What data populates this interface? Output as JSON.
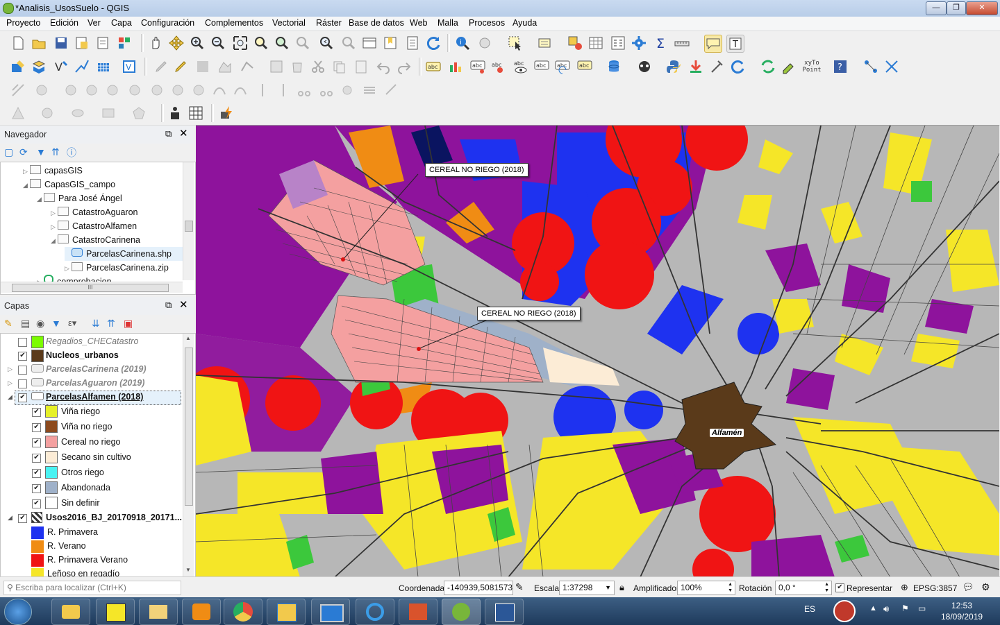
{
  "window": {
    "title": "*Analisis_UsosSuelo - QGIS",
    "minimize": "—",
    "maximize": "❐",
    "close": "✕"
  },
  "menu": [
    "Proyecto",
    "Edición",
    "Ver",
    "Capa",
    "Configuración",
    "Complementos",
    "Vectorial",
    "Ráster",
    "Base de datos",
    "Web",
    "Malla",
    "Procesos",
    "Ayuda"
  ],
  "toolbar": {
    "xyto_label": "xyTo",
    "xyto_label2": "Point"
  },
  "navigator": {
    "title": "Navegador",
    "items": [
      {
        "label": "capasGIS",
        "indent": 0,
        "expanded": false
      },
      {
        "label": "CapasGIS_campo",
        "indent": 0,
        "expanded": true
      },
      {
        "label": "Para José Ángel",
        "indent": 1,
        "expanded": true
      },
      {
        "label": "CatastroAguaron",
        "indent": 2,
        "expanded": false
      },
      {
        "label": "CatastroAlfamen",
        "indent": 2,
        "expanded": false
      },
      {
        "label": "CatastroCarinena",
        "indent": 2,
        "expanded": true
      },
      {
        "label": "ParcelasCarinena.shp",
        "indent": 3,
        "expanded": null
      },
      {
        "label": "ParcelasCarinena.zip",
        "indent": 3,
        "expanded": false
      },
      {
        "label": "comprobacion",
        "indent": 1,
        "expanded": null
      }
    ],
    "hscroll_thumb": "III"
  },
  "layers": {
    "title": "Capas",
    "items": [
      {
        "label": "Regadios_CHECatastro",
        "checked": false,
        "style": "italic",
        "swatch": "#7cfc00"
      },
      {
        "label": "Nucleos_urbanos",
        "checked": true,
        "style": "bold",
        "swatch": "#5a3a1a"
      },
      {
        "label": "ParcelasCarinena (2019)",
        "checked": false,
        "style": "italic-bold",
        "swatch": null
      },
      {
        "label": "ParcelasAguaron (2019)",
        "checked": false,
        "style": "italic-bold",
        "swatch": null
      },
      {
        "label": "ParcelasAlfamen (2018)",
        "checked": true,
        "style": "bold-underline",
        "swatch": null
      }
    ],
    "categories": [
      {
        "label": "Viña riego",
        "checked": true,
        "color": "#e6f028"
      },
      {
        "label": "Viña no riego",
        "checked": true,
        "color": "#8c4a1e"
      },
      {
        "label": "Cereal no riego",
        "checked": true,
        "color": "#f4a0a0"
      },
      {
        "label": "Secano sin cultivo",
        "checked": true,
        "color": "#fcecd6"
      },
      {
        "label": "Otros riego",
        "checked": true,
        "color": "#4af2f2"
      },
      {
        "label": "Abandonada",
        "checked": true,
        "color": "#9fb1c9"
      },
      {
        "label": "Sin definir",
        "checked": true,
        "color": "#ffffff"
      }
    ],
    "raster": {
      "label": "Usos2016_BJ_20170918_20171...",
      "checked": true
    },
    "raster_classes": [
      {
        "label": "R. Primavera",
        "color": "#1e32f0"
      },
      {
        "label": "R. Verano",
        "color": "#f08c14"
      },
      {
        "label": "R. Primavera Verano",
        "color": "#f01414"
      },
      {
        "label": "Leñoso en regadío",
        "color": "#f5e628"
      }
    ]
  },
  "map": {
    "callouts": [
      "CEREAL NO RIEGO (2018)",
      "CEREAL NO RIEGO (2018)"
    ],
    "town_label": "Alfamén"
  },
  "statusbar": {
    "locator_placeholder": "Escriba para localizar (Ctrl+K)",
    "coord_label": "Coordenada",
    "coord_value": "-140939,5081573",
    "scale_label": "Escala",
    "scale_value": "1:37298",
    "magnifier_label": "Amplificador",
    "magnifier_value": "100%",
    "rotation_label": "Rotación",
    "rotation_value": "0,0 °",
    "render_label": "Representar",
    "crs": "EPSG:3857"
  },
  "taskbar": {
    "lang": "ES",
    "time": "12:53",
    "date": "18/09/2019"
  }
}
